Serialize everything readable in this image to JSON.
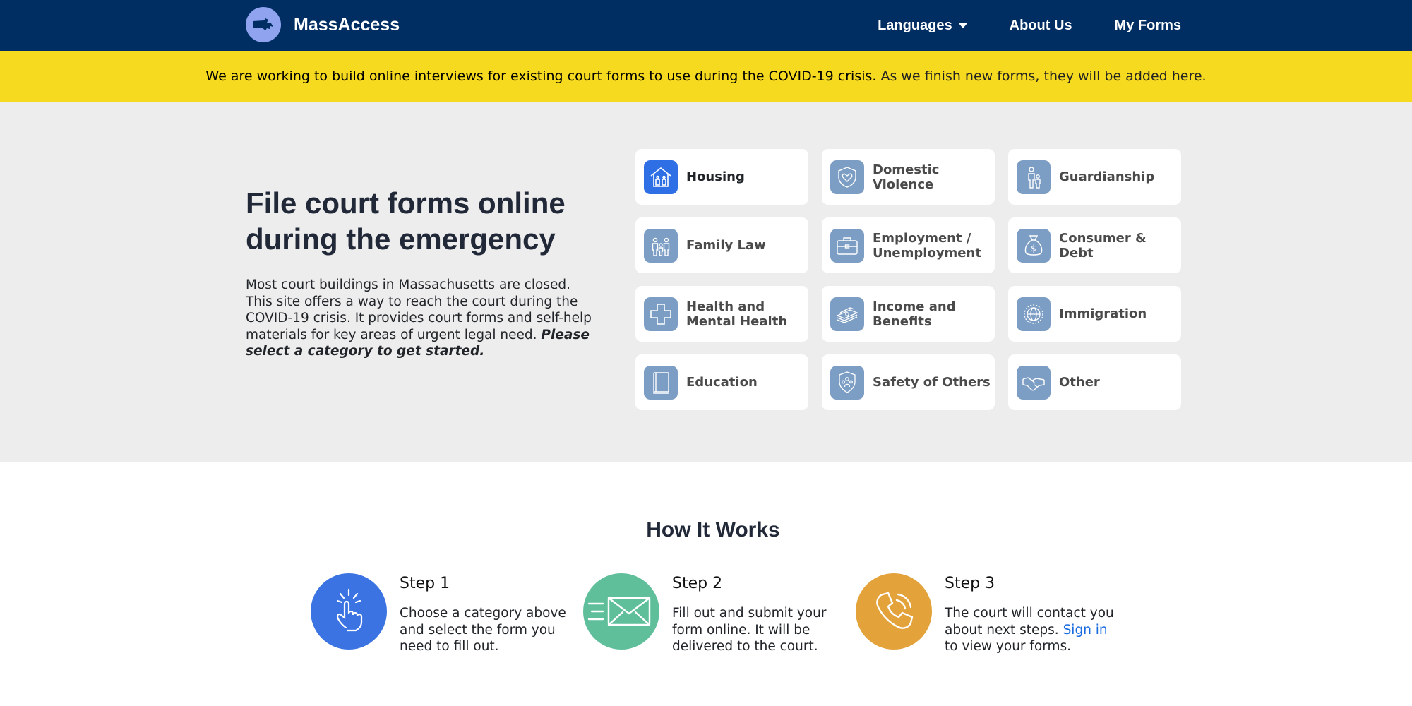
{
  "navbar": {
    "brand": "MassAccess",
    "links": {
      "languages": "Languages",
      "about": "About Us",
      "my_forms": "My Forms"
    },
    "background": "#002d62"
  },
  "alert": {
    "bold_text": "We are working to build online interviews for existing court forms to use during the COVID-19 crisis.",
    "rest_text": "As we finish new forms, they will be added here.",
    "background": "#f6da1f"
  },
  "hero": {
    "title": "File court forms online during the emergency",
    "text": "Most court buildings in Massachusetts are closed. This site offers a way to reach the court during the COVID-19 crisis. It provides court forms and self-help materials for key areas of urgent legal need.",
    "text_emphasis": "Please select a category to get started."
  },
  "categories": [
    {
      "label": "Housing",
      "icon": "house-icon"
    },
    {
      "label": "Domestic Violence",
      "icon": "shield-heart-icon"
    },
    {
      "label": "Guardianship",
      "icon": "parent-child-icon"
    },
    {
      "label": "Family Law",
      "icon": "family-icon"
    },
    {
      "label": "Employment / Unemployment",
      "icon": "briefcase-icon"
    },
    {
      "label": "Consumer & Debt",
      "icon": "money-bag-icon"
    },
    {
      "label": "Health and Mental Health",
      "icon": "medical-cross-icon"
    },
    {
      "label": "Income and Benefits",
      "icon": "cash-stack-icon"
    },
    {
      "label": "Immigration",
      "icon": "globe-seal-icon"
    },
    {
      "label": "Education",
      "icon": "book-icon"
    },
    {
      "label": "Safety of Others",
      "icon": "people-shield-icon"
    },
    {
      "label": "Other",
      "icon": "handshake-icon"
    }
  ],
  "how_it_works": {
    "title": "How It Works",
    "steps": [
      {
        "title": "Step 1",
        "text": "Choose a category above and select the form you need to fill out.",
        "color": "#3b74e2",
        "icon": "pointing-hand-icon"
      },
      {
        "title": "Step 2",
        "text": "Fill out and submit your form online. It will be delivered to the court.",
        "color": "#5fbf9b",
        "icon": "envelope-icon"
      },
      {
        "title": "Step 3",
        "text_before": "The court will contact you about next steps.",
        "link": "Sign in",
        "text_after": "to view your forms.",
        "color": "#e3a23a",
        "icon": "phone-icon"
      }
    ]
  }
}
